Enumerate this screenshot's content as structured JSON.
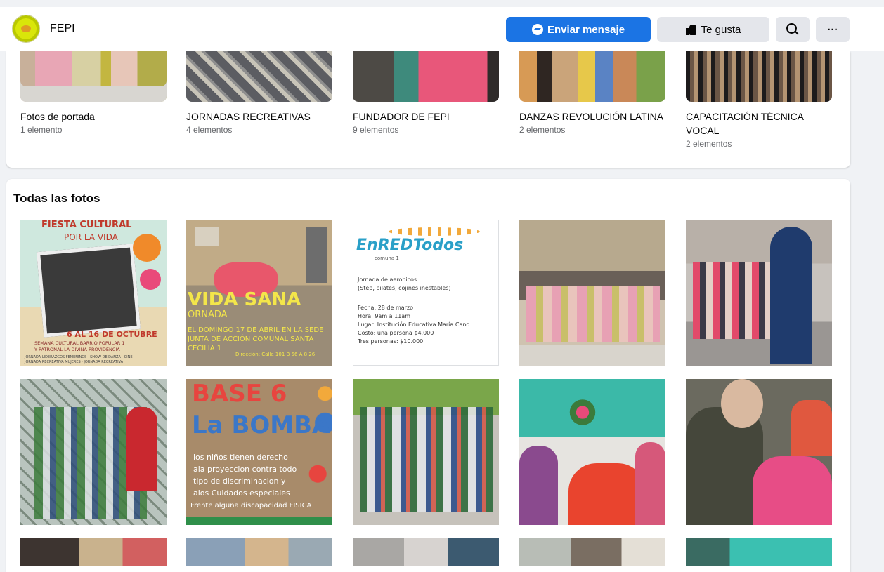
{
  "header": {
    "page_name": "FEPI",
    "message_button": "Enviar mensaje",
    "like_button": "Te gusta",
    "more_button": "···"
  },
  "albums": [
    {
      "name": "Fotos de portada",
      "count": "1 elemento",
      "icon": "cover-photo"
    },
    {
      "name": "JORNADAS RECREATIVAS",
      "count": "4 elementos"
    },
    {
      "name": "FUNDADOR DE FEPI",
      "count": "9 elementos"
    },
    {
      "name": "DANZAS REVOLUCIÓN LATINA",
      "count": "2 elementos"
    },
    {
      "name": "CAPACITACIÓN TÉCNICA VOCAL",
      "count": "2 elementos"
    }
  ],
  "photos_section": {
    "title": "Todas las fotos"
  },
  "posters": {
    "fiesta": {
      "line1": "FIESTA CULTURAL",
      "line2": "POR LA VIDA",
      "dates": "6 AL 16 DE OCTUBRE",
      "sub1": "SEMANA CULTURAL BARRIO POPULAR 1",
      "sub2": "Y PATRONAL LA DIVINA PROVIDENCIA",
      "sub3": "JORNADA LIDERAZGOS FEMENINOS · SHOW DE DANZA · CINE",
      "sub4": "JORNADA RECREATIVA MUJERES · JORNADA RECREATIVA"
    },
    "vida": {
      "big": "VIDA SANA",
      "sub": "ORNADA",
      "line1": "EL DOMINGO 17 DE ABRIL EN LA SEDE",
      "line2": "JUNTA DE ACCIÓN COMUNAL SANTA",
      "line3": "CECILIA 1",
      "dir": "Dirección: Calle 101 B 56 A 8 26"
    },
    "enred": {
      "logo": "EnREDTodos",
      "sublogo": "comuna 1",
      "l1": "Jornada de aerobicos",
      "l2": "(Step, pilates, cojines inestables)",
      "l3": "Fecha: 28 de marzo",
      "l4": "Hora: 9am a 11am",
      "l5": "Lugar: Institución Educativa María Cano",
      "l6": "Costo:  una persona $4.000",
      "l7": "Tres personas: $10.000"
    },
    "base6": {
      "title": "BASE 6",
      "title2": "La BOMBA",
      "t1": "los niños tienen derecho",
      "t2": "ala proyeccion contra todo",
      "t3": "tipo de discriminacion y",
      "t4": "alos Cuidados especiales",
      "t5": "Frente alguna discapacidad FISICA"
    }
  },
  "colors": {
    "primary": "#1b74e4",
    "secondary_button": "#e4e6eb",
    "background": "#f0f2f5",
    "muted_text": "#65676b"
  }
}
